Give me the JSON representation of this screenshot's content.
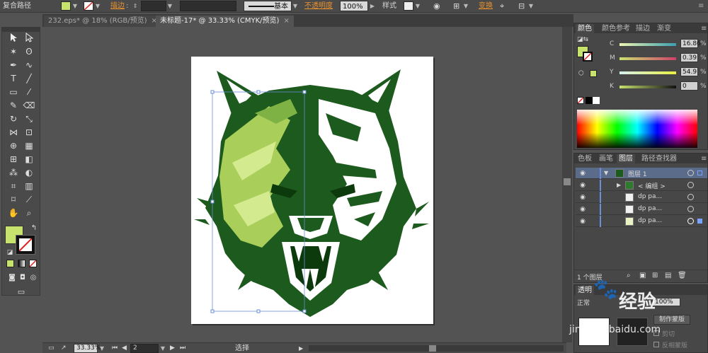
{
  "control_bar": {
    "object_type": "复合路径",
    "stroke_label": "描边",
    "stroke_style": "基本",
    "opacity_label": "不透明度",
    "opacity_value": "100%",
    "style_label": "样式",
    "transform_label": "变换",
    "fill_color": "#c8e26e"
  },
  "tabs": [
    {
      "label": "232.eps* @ 18% (RGB/预览)"
    },
    {
      "label": "未标题-17* @ 33.33% (CMYK/预览)"
    }
  ],
  "status": {
    "zoom": "33.33%",
    "page": "2",
    "tool": "选择"
  },
  "color_panel": {
    "tabs": [
      "颜色",
      "颜色参考",
      "描边",
      "渐变"
    ],
    "c_label": "C",
    "c_value": "16.86",
    "m_label": "M",
    "m_value": "0.39",
    "y_label": "Y",
    "y_value": "54.9",
    "k_label": "K",
    "k_value": "0",
    "unit": "%",
    "fill_color": "#c8e26e"
  },
  "layers_panel": {
    "tabs": [
      "色板",
      "画笔",
      "图层",
      "路径查找器"
    ],
    "rows": [
      {
        "name": "图层 1"
      },
      {
        "name": "< 编组 >"
      },
      {
        "name": "dp pa..."
      },
      {
        "name": "dp pa..."
      },
      {
        "name": "dp pa..."
      }
    ],
    "footer": "1 个图层"
  },
  "transparency_panel": {
    "tab": "透明",
    "mode": "正常",
    "opacity": "100%",
    "make_mask": "制作蒙版",
    "clip": "剪切",
    "invert_mask": "反相蒙版"
  },
  "watermark": {
    "text": "经验",
    "domain": "jingyan.baidu.com"
  }
}
